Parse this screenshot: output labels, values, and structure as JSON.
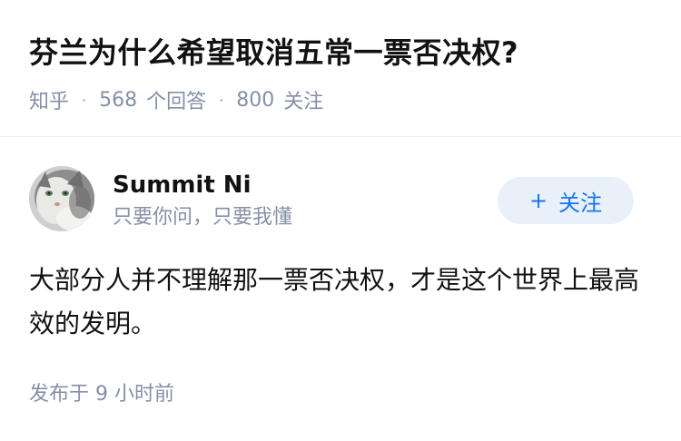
{
  "question": {
    "title": "芬兰为什么希望取消五常一票否决权?",
    "source": "知乎",
    "separator": "·",
    "answer_count": "568",
    "answer_label": "个回答",
    "follower_count": "800",
    "follower_label": "关注"
  },
  "author": {
    "name": "Summit Ni",
    "bio": "只要你问，只要我懂",
    "avatar_icon": "cat-avatar"
  },
  "follow_button": {
    "icon": "plus-icon",
    "plus": "+",
    "label": "关注",
    "color": "#1772f6",
    "background": "#e8f0fa"
  },
  "answer": {
    "content": "大部分人并不理解那一票否决权，才是这个世界上最高效的发明。",
    "published_label": "发布于",
    "published_value": "9 小时前"
  }
}
